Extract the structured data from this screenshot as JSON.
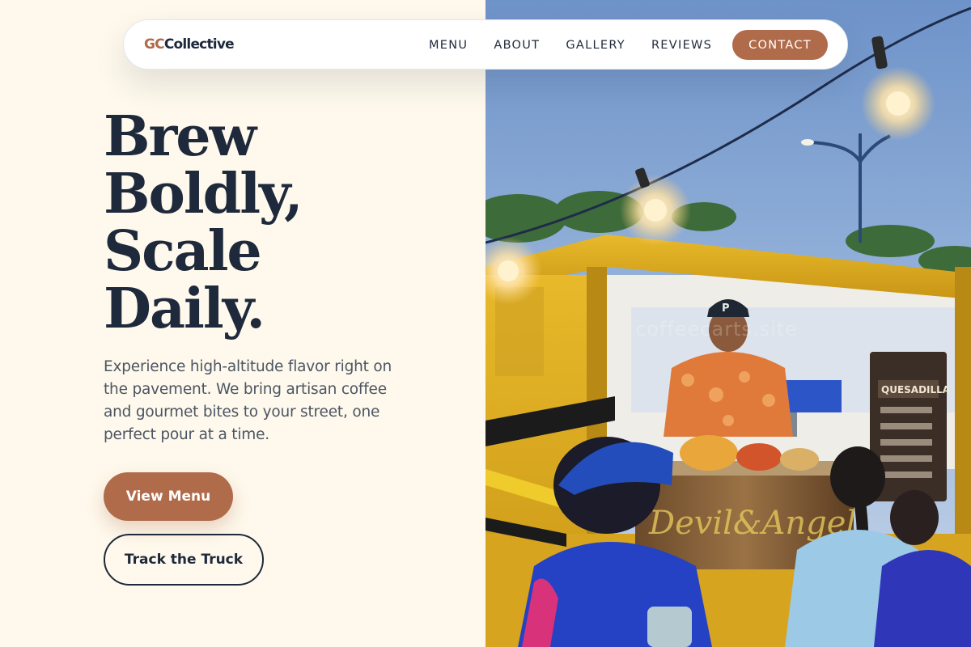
{
  "brand": {
    "mark": "GC",
    "name": "Collective",
    "accent_color": "#B06B4A",
    "ink_color": "#1E293B",
    "background_color": "#FEF9EC"
  },
  "nav": {
    "links": [
      {
        "label": "MENU"
      },
      {
        "label": "ABOUT"
      },
      {
        "label": "GALLERY"
      },
      {
        "label": "REVIEWS"
      }
    ],
    "cta_label": "CONTACT"
  },
  "hero": {
    "headline_lines": [
      "Brew",
      "Boldly,",
      "Scale",
      "Daily."
    ],
    "lead": "Experience high-altitude flavor right on the pavement. We bring artisan coffee and gourmet bites to your street, one perfect pour at a time.",
    "primary_button": "View Menu",
    "secondary_button": "Track the Truck"
  },
  "photo": {
    "subject": "food-truck-vendor-photo",
    "watermark": "coffeecarts.site",
    "sign_text": "QUESADILLA",
    "truck_text": "Devil&Angel"
  }
}
